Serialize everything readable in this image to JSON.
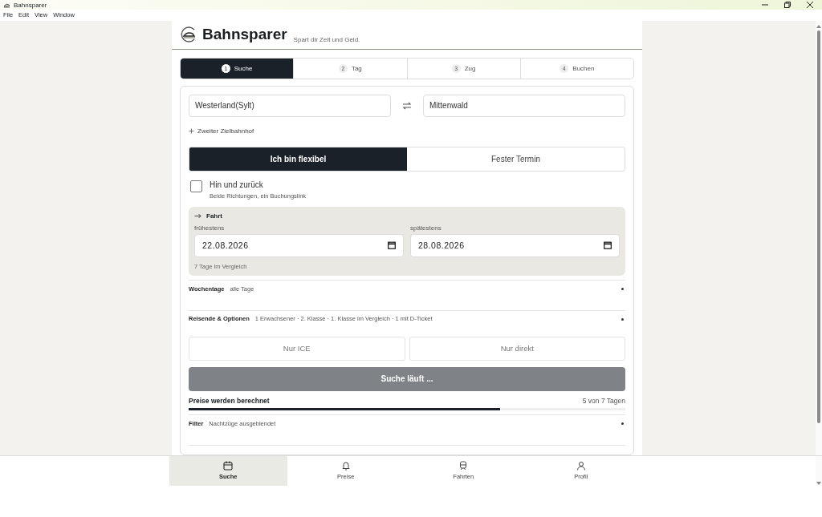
{
  "window": {
    "title": "Bahnsparer"
  },
  "menu": [
    "File",
    "Edit",
    "View",
    "Window"
  ],
  "header": {
    "brand": "Bahnsparer",
    "tagline": "Spart dir Zeit und Geld."
  },
  "steps": [
    {
      "number": "1",
      "label": "Suche",
      "selected": true
    },
    {
      "number": "2",
      "label": "Tag",
      "selected": false
    },
    {
      "number": "3",
      "label": "Zug",
      "selected": false
    },
    {
      "number": "4",
      "label": "Buchen",
      "selected": false
    }
  ],
  "route": {
    "from": "Westerland(Sylt)",
    "to": "Mittenwald",
    "add_destination": "Zweiter Zielbahnhof"
  },
  "mode_toggle": [
    {
      "label": "Ich bin flexibel",
      "selected": true
    },
    {
      "label": "Fester Termin",
      "selected": false
    }
  ],
  "round_trip": {
    "label": "Hin und zurück",
    "hint": "Beide Richtungen, ein Buchungslink",
    "checked": false
  },
  "trip_panel": {
    "title": "Fahrt",
    "earliest": {
      "label": "frühestens",
      "value": "22.08.2026"
    },
    "latest": {
      "label": "spätestens",
      "value": "28.08.2026"
    },
    "note": "7 Tage im Vergleich"
  },
  "settings_rows": [
    {
      "label": "Wochentage",
      "value": "alle Tage"
    },
    {
      "label": "Reisende & Optionen",
      "value": "1 Erwachsener · 2. Klasse · 1. Klasse im Vergleich · 1 mit D-Ticket"
    }
  ],
  "train_filters": [
    {
      "label": "Nur ICE",
      "on": false
    },
    {
      "label": "Nur direkt",
      "on": false
    }
  ],
  "search_button": {
    "label": "Suche läuft ...",
    "disabled": true
  },
  "progress": {
    "label": "Preise werden berechnet",
    "reading": "5 von 7 Tagen",
    "level": 0.714
  },
  "filter_row": {
    "label": "Filter",
    "value": "Nachtzüge ausgeblendet"
  },
  "nav": [
    {
      "label": "Suche",
      "selected": true
    },
    {
      "label": "Preise",
      "selected": false
    },
    {
      "label": "Fahrten",
      "selected": false
    },
    {
      "label": "Profil",
      "selected": false
    }
  ]
}
